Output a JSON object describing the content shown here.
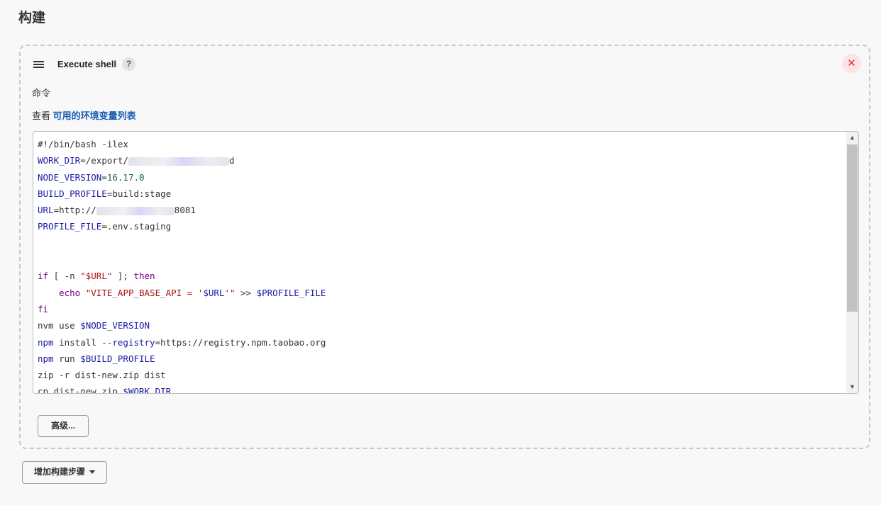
{
  "section": {
    "title": "构建"
  },
  "step": {
    "title": "Execute shell",
    "help_label": "?",
    "close_label": "✕",
    "command_label": "命令",
    "env_prefix": "查看",
    "env_link": "可用的环境变量列表"
  },
  "code": {
    "line1": "#!/bin/bash -ilex",
    "l2_var": "WORK_DIR",
    "l2_val": "=/export/",
    "l2_tail": "d",
    "l3_var": "NODE_VERSION",
    "l3_eq": "=",
    "l3_num": "16.17.0",
    "l4_var": "BUILD_PROFILE",
    "l4_val": "=build:stage",
    "l5_var": "URL",
    "l5_val": "=http://",
    "l5_tail": "8081",
    "l6_var": "PROFILE_FILE",
    "l6_val": "=.env.staging",
    "l9_if": "if",
    "l9_a": " [ -n ",
    "l9_str": "\"$URL\"",
    "l9_b": " ]; ",
    "l9_then": "then",
    "l10_indent": "    ",
    "l10_echo": "echo",
    "l10_sp": " ",
    "l10_s1": "\"VITE_APP_BASE_API = '",
    "l10_var": "$URL",
    "l10_s2": "'\"",
    "l10_op": " >> ",
    "l10_file": "$PROFILE_FILE",
    "l11_fi": "fi",
    "l12_a": "nvm use ",
    "l12_var": "$NODE_VERSION",
    "l13_a": "npm",
    "l13_b": " install --",
    "l13_c": "registry",
    "l13_d": "=https://registry.npm.taobao.org",
    "l14_a": "npm",
    "l14_b": " run ",
    "l14_var": "$BUILD_PROFILE",
    "l15": "zip -r dist-new.zip dist",
    "l16_a": "cp dist-new.zip ",
    "l16_var": "$WORK_DIR"
  },
  "scrollbar": {
    "up": "▲",
    "down": "▼"
  },
  "buttons": {
    "advanced": "高级...",
    "add_step": "增加构建步骤"
  }
}
